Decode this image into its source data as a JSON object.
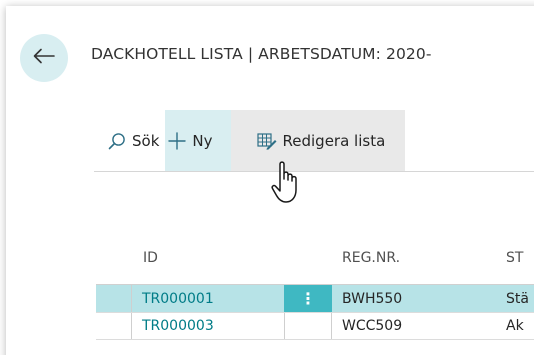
{
  "header": {
    "title": "DACKHOTELL LISTA | ARBETSDATUM: 2020-"
  },
  "actions": {
    "search_label": "Sök",
    "new_label": "Ny",
    "edit_list_label": "Redigera lista"
  },
  "table": {
    "columns": [
      "ID",
      "REG.NR.",
      "ST"
    ],
    "rows": [
      {
        "id": "TR000001",
        "reg": "BWH550",
        "status": "Stä",
        "selected": true
      },
      {
        "id": "TR000003",
        "reg": "WCC509",
        "status": "Ak",
        "selected": false
      }
    ],
    "row_menu_glyph": "⋮"
  },
  "colors": {
    "accent": "#3fb8c2",
    "selected_row": "#b7e3e7",
    "new_action_bg": "#d9eef1",
    "link": "#007c87"
  },
  "icons": {
    "back": "arrow-left-icon",
    "search": "search-icon",
    "new": "plus-icon",
    "edit_list": "edit-list-icon",
    "cursor": "hand-pointer-icon"
  }
}
